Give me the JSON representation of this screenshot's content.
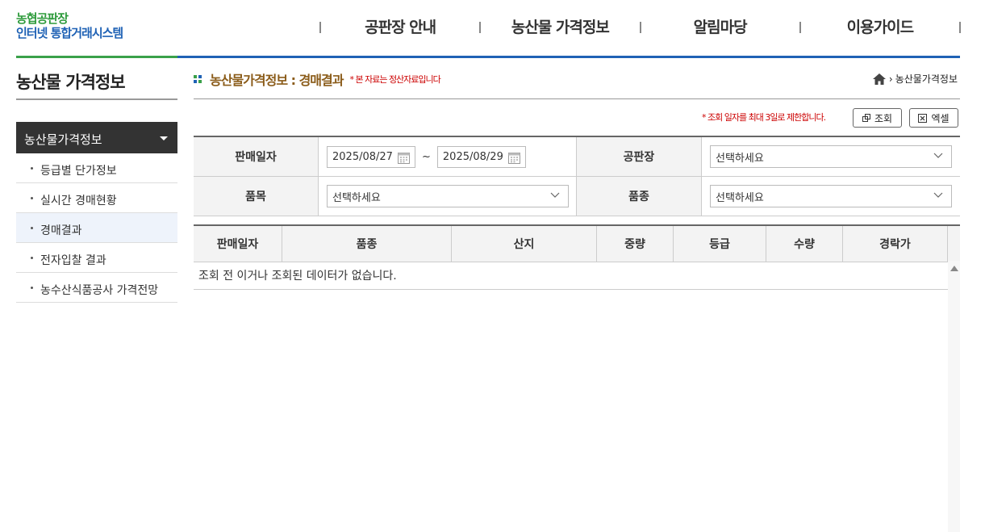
{
  "header": {
    "logo_line1": "농협공판장",
    "logo_line2": "인터넷 통합거래시스템",
    "nav": [
      "공판장 안내",
      "농산물 가격정보",
      "알림마당",
      "이용가이드"
    ]
  },
  "sidebar": {
    "title": "농산물 가격정보",
    "group": "농산물가격정보",
    "items": [
      {
        "label": "등급별 단가정보"
      },
      {
        "label": "실시간 경매현황"
      },
      {
        "label": "경매결과"
      },
      {
        "label": "전자입찰 결과"
      },
      {
        "label": "농수산식품공사 가격전망"
      }
    ]
  },
  "content": {
    "title": "농산물가격정보 : 경매결과",
    "note": "* 본 자료는 정산자료입니다",
    "breadcrumb": "농산물가격정보",
    "limit_note": "* 조회 일자를 최대 3일로 제한합니다.",
    "search_button": "조회",
    "excel_button": "엑셀"
  },
  "form": {
    "sale_date_label": "판매일자",
    "date_from": "2025/08/27",
    "date_to": "2025/08/29",
    "tilde": "~",
    "market_label": "공판장",
    "market_value": "선택하세요",
    "item_label": "품목",
    "item_value": "선택하세요",
    "variety_label": "품종",
    "variety_value": "선택하세요"
  },
  "table": {
    "columns": [
      "판매일자",
      "품종",
      "산지",
      "중량",
      "등급",
      "수량",
      "경락가"
    ],
    "empty_message": "조회 전 이거나 조회된 데이터가 없습니다."
  },
  "colors": {
    "green": "#3aa14a",
    "blue": "#1f62b5",
    "title_brown": "#8b5c1a",
    "note_red": "#cc0000"
  }
}
